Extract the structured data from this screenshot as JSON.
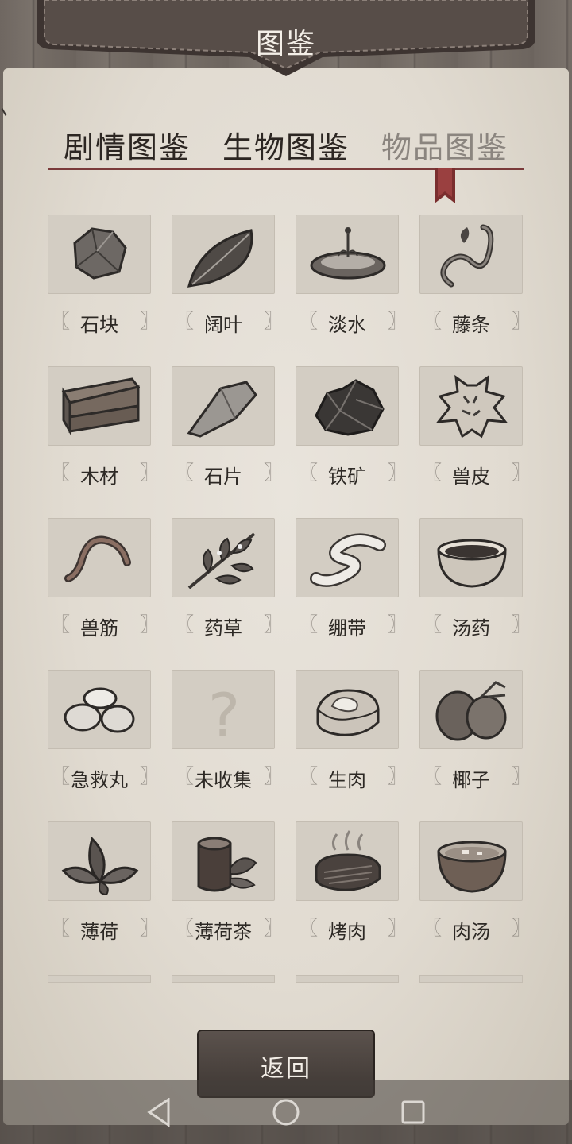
{
  "header": {
    "title": "图鉴"
  },
  "tabs": [
    {
      "label": "剧情图鉴",
      "active": false
    },
    {
      "label": "生物图鉴",
      "active": false
    },
    {
      "label": "物品图鉴",
      "active": true
    }
  ],
  "items": [
    {
      "label": "石块",
      "icon": "stone-icon"
    },
    {
      "label": "阔叶",
      "icon": "leaf-icon"
    },
    {
      "label": "淡水",
      "icon": "water-icon"
    },
    {
      "label": "藤条",
      "icon": "vine-icon"
    },
    {
      "label": "木材",
      "icon": "wood-planks-icon"
    },
    {
      "label": "石片",
      "icon": "stone-flake-icon"
    },
    {
      "label": "铁矿",
      "icon": "iron-ore-icon"
    },
    {
      "label": "兽皮",
      "icon": "animal-hide-icon"
    },
    {
      "label": "兽筋",
      "icon": "sinew-icon"
    },
    {
      "label": "药草",
      "icon": "herb-icon"
    },
    {
      "label": "绷带",
      "icon": "bandage-icon"
    },
    {
      "label": "汤药",
      "icon": "medicine-bowl-icon"
    },
    {
      "label": "急救丸",
      "icon": "pills-icon"
    },
    {
      "label": "未收集",
      "icon": "question-mark-icon"
    },
    {
      "label": "生肉",
      "icon": "raw-meat-icon"
    },
    {
      "label": "椰子",
      "icon": "coconut-icon"
    },
    {
      "label": "薄荷",
      "icon": "mint-icon"
    },
    {
      "label": "薄荷茶",
      "icon": "mint-tea-icon"
    },
    {
      "label": "烤肉",
      "icon": "roast-meat-icon"
    },
    {
      "label": "肉汤",
      "icon": "meat-soup-icon"
    }
  ],
  "back_button": {
    "label": "返回"
  },
  "nav": {
    "back": "nav-back-icon",
    "home": "nav-home-icon",
    "recent": "nav-recent-icon"
  }
}
